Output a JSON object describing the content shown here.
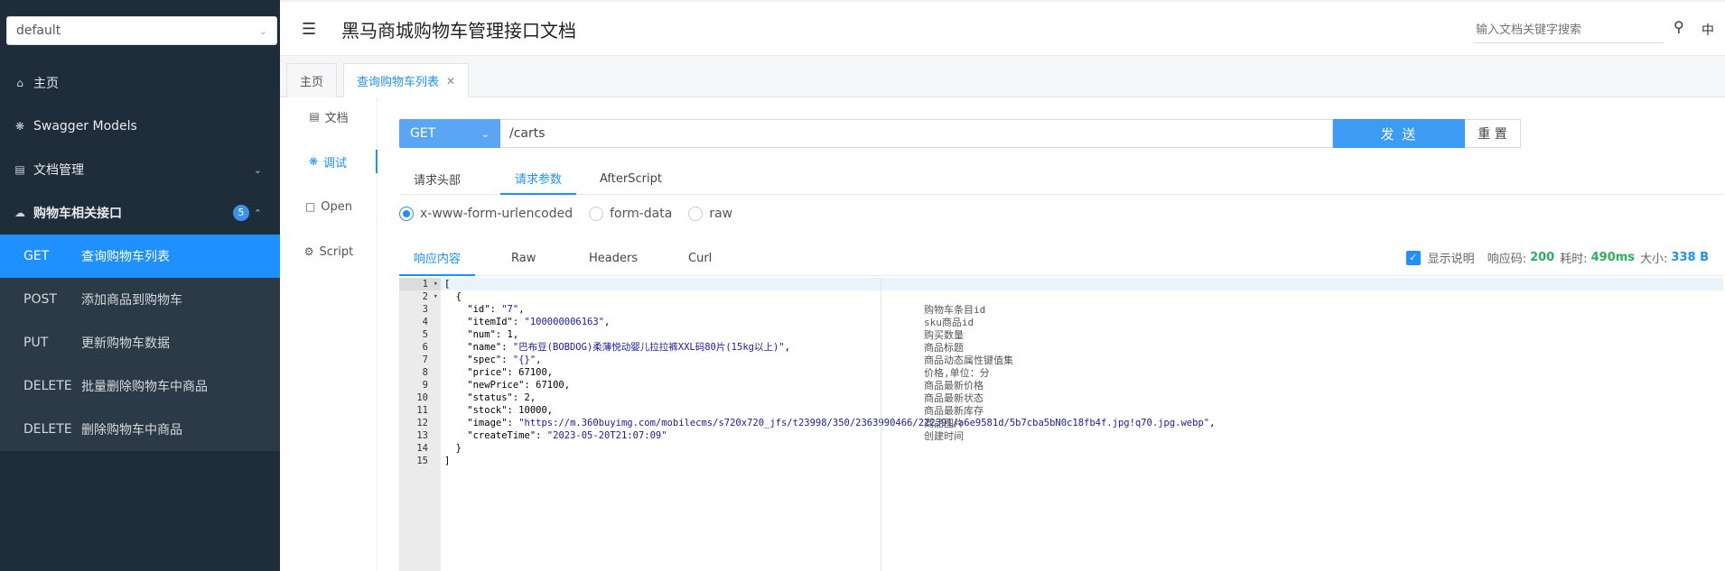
{
  "sidebar": {
    "group_select": "default",
    "nav": [
      {
        "label": "主页",
        "icon": "home-icon"
      },
      {
        "label": "Swagger Models",
        "icon": "cube-icon"
      },
      {
        "label": "文档管理",
        "icon": "doc-manage-icon"
      },
      {
        "label": "购物车相关接口",
        "icon": "cloud-icon",
        "badge": "5"
      }
    ],
    "apis": [
      {
        "method": "GET",
        "label": "查询购物车列表"
      },
      {
        "method": "POST",
        "label": "添加商品到购物车"
      },
      {
        "method": "PUT",
        "label": "更新购物车数据"
      },
      {
        "method": "DELETE",
        "label": "批量删除购物车中商品"
      },
      {
        "method": "DELETE",
        "label": "删除购物车中商品"
      }
    ]
  },
  "header": {
    "title": "黑马商城购物车管理接口文档",
    "search_placeholder": "输入文档关键字搜索",
    "lang": "中"
  },
  "tabs": [
    {
      "label": "主页"
    },
    {
      "label": "查询购物车列表"
    }
  ],
  "subnav": [
    "文档",
    "调试",
    "Open",
    "Script"
  ],
  "request": {
    "method": "GET",
    "url": "/carts",
    "send": "发 送",
    "reset": "重 置",
    "tabs": [
      "请求头部",
      "请求参数",
      "AfterScript"
    ],
    "body_types": [
      "x-www-form-urlencoded",
      "form-data",
      "raw"
    ]
  },
  "response": {
    "tabs": [
      "响应内容",
      "Raw",
      "Headers",
      "Curl"
    ],
    "show_desc": "显示说明",
    "code_label": "响应码:",
    "code": "200",
    "time_label": "耗时:",
    "time": "490ms",
    "size_label": "大小:",
    "size": "338 B",
    "lines": [
      "[",
      "  {",
      "    \"id\": \"7\",",
      "    \"itemId\": \"100000006163\",",
      "    \"num\": 1,",
      "    \"name\": \"巴布豆(BOBDOG)柔薄悦动婴儿拉拉裤XXL码80片(15kg以上)\",",
      "    \"spec\": \"{}\",",
      "    \"price\": 67100,",
      "    \"newPrice\": 67100,",
      "    \"status\": 2,",
      "    \"stock\": 10000,",
      "    \"image\": \"https://m.360buyimg.com/mobilecms/s720x720_jfs/t23998/350/2363990466/222391/a6e9581d/5b7cba5bN0c18fb4f.jpg!q70.jpg.webp\",",
      "    \"createTime\": \"2023-05-20T21:07:09\"",
      "  }",
      "]"
    ],
    "descriptions": [
      "购物车条目id",
      "sku商品id",
      "购买数量",
      "商品标题",
      "商品动态属性键值集",
      "价格,单位：分",
      "商品最新价格",
      "商品最新状态",
      "商品最新库存",
      "商品图片",
      "创建时间"
    ]
  }
}
